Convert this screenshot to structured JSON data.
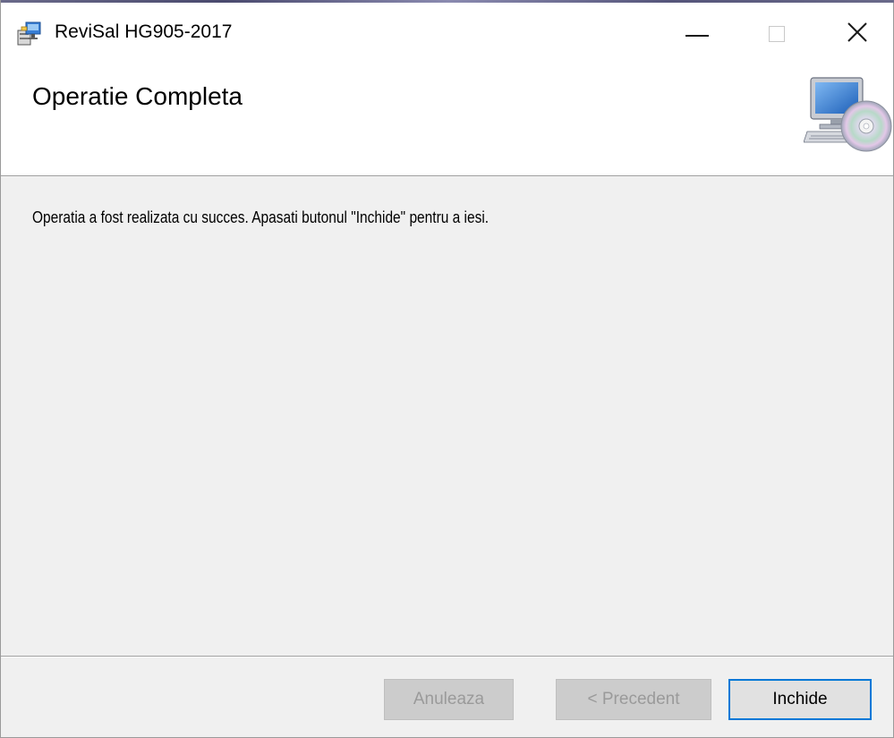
{
  "window": {
    "title": "ReviSal HG905-2017"
  },
  "header": {
    "title": "Operatie Completa"
  },
  "body": {
    "message": "Operatia a fost realizata cu succes. Apasati butonul \"Inchide\" pentru a iesi."
  },
  "buttons": {
    "cancel_label": "Anuleaza",
    "previous_label": "< Precedent",
    "close_label": "Inchide"
  },
  "icons": {
    "app": "installer-package-icon",
    "header": "computer-cd-icon",
    "minimize": "minimize-icon",
    "maximize": "maximize-icon",
    "close": "close-icon"
  },
  "colors": {
    "focus_border": "#0078d7",
    "panel_background": "#f0f0f0",
    "header_background": "#ffffff"
  }
}
